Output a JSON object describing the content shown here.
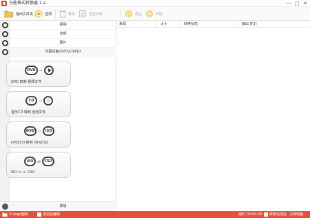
{
  "window": {
    "title": "万能格式转换器 1.2",
    "min": "—",
    "max": "□",
    "close": "✕"
  },
  "toolbar": {
    "output_folder": "输出文件夹",
    "options": "选项",
    "remove": "移除",
    "clear_list": "清空列表",
    "stop": "停止",
    "start": "开始"
  },
  "categories": {
    "video": "视频",
    "audio": "音频",
    "picture": "图片",
    "rom": "光驱设备\\DVD\\CD\\ISO"
  },
  "cards": [
    {
      "label": "DVD 转到 视频文件",
      "art_left": "DVD"
    },
    {
      "label": "音乐CD 转到 音频文件",
      "art_left": "CD",
      "art_right": "♫"
    },
    {
      "label": "DVD/CD 转到 ISO/CSO",
      "art_left": "DVD",
      "art_right": "ISO"
    },
    {
      "label": "ISO <--> CSO",
      "art_left": "ISO",
      "art_right": "CSO"
    }
  ],
  "advanced": "高级",
  "list": {
    "col_source": "来源",
    "col_size": "大小",
    "col_status": "转换状态",
    "col_output": "输出 [F2]"
  },
  "status": {
    "path": "D:\\logo图库",
    "open_folder": "添加后编辑",
    "elapsed_label": "用时",
    "elapsed": "00:00:00",
    "after_convert": "转换完成后",
    "shutdown": "关闭电脑"
  },
  "colors": {
    "accent": "#e0533a",
    "options_icon": "#f2a800",
    "start_icon": "#f2c21a"
  }
}
